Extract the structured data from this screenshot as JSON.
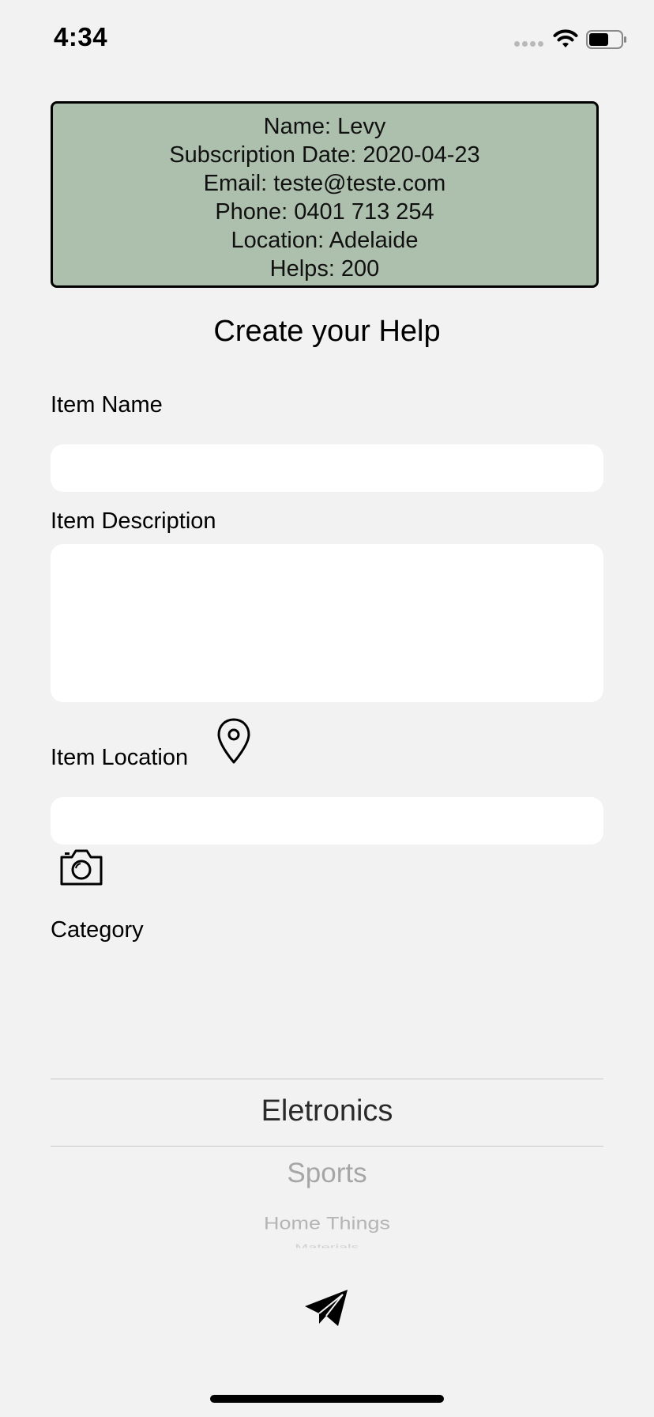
{
  "status_bar": {
    "time": "4:34"
  },
  "profile": {
    "name_line": "Name: Levy",
    "subscription_line": "Subscription Date: 2020-04-23",
    "email_line": "Email: teste@teste.com",
    "phone_line": "Phone: 0401 713 254",
    "location_line": "Location: Adelaide",
    "helps_line": "Helps: 200"
  },
  "form": {
    "title": "Create your Help",
    "item_name_label": "Item Name",
    "item_name_value": "",
    "item_description_label": "Item Description",
    "item_description_value": "",
    "item_location_label": "Item Location",
    "item_location_value": "",
    "category_label": "Category"
  },
  "category_picker": {
    "selected": "Eletronics",
    "options_below": [
      "Sports",
      "Home Things",
      "Materials"
    ]
  },
  "icons": {
    "location": "location-pin-icon",
    "camera": "camera-icon",
    "send": "paper-plane-icon"
  },
  "colors": {
    "background": "#f2f2f2",
    "profile_card": "#adbfad",
    "field": "#ffffff"
  }
}
